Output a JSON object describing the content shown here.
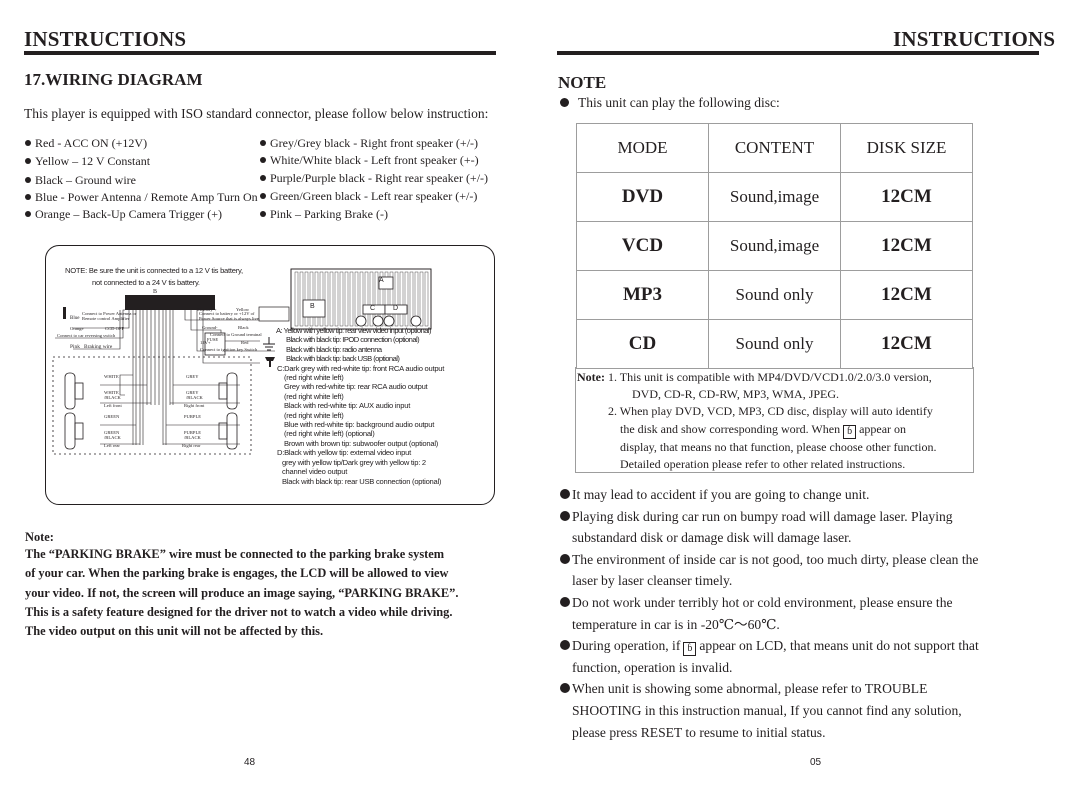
{
  "left_page": {
    "header": "INSTRUCTIONS",
    "section_title": "17.WIRING DIAGRAM",
    "intro": "This player is equipped with ISO standard connector, please follow below instruction:",
    "wires_left": [
      "Red - ACC ON (+12V)",
      "Yellow – 12 V Constant",
      "Black – Ground wire",
      "Blue - Power Antenna / Remote Amp Turn On",
      "Orange – Back-Up Camera Trigger (+)"
    ],
    "wires_right": [
      "Grey/Grey black - Right front speaker (+/-)",
      "White/White black - Left front speaker (+-)",
      "Purple/Purple black - Right rear speaker (+/-)",
      "Green/Green black - Left rear speaker (+/-)",
      "Pink – Parking Brake (-)"
    ],
    "diagram": {
      "note_line1": "NOTE: Be sure the unit is connected to a 12 V tis battery,",
      "note_line2": "not connected to a 24 V tis battery.",
      "connector_b_label": "B",
      "blue_label": "Blue",
      "blue_desc": "Connect to Power Antenna or Remote control Amplifier",
      "orange_label": "Orange",
      "ccd_label": "CCD OFF",
      "reversing_desc": "Connect to car reversing switch",
      "pink_label": "Pink",
      "braking_label": "Braking wire",
      "memory_label": "Memory +",
      "yellow_label": "Yellow",
      "memory_desc": "Connect to battery or +12V of Power Source that is always live.",
      "fuse_label": "FUSE",
      "ground_label": "Ground-",
      "black_label": "Black",
      "ground_desc": "Connect to Ground terminal",
      "v12_label": "12V+",
      "red_label": "Red",
      "ignition_desc": "Connect to ignition key Switch",
      "speakers": {
        "lf_plus": "WHITE",
        "lf_minus": "WHITE /BLACK",
        "lf_caption": "Left front",
        "rf_plus": "GREY",
        "rf_minus": "GREY /BLACK",
        "rf_caption": "Right front",
        "lr_plus": "GREEN",
        "lr_minus": "GREEN /BLACK",
        "lr_caption": "Left rear",
        "rr_plus": "PURPLE",
        "rr_minus": "PURPLE /BLACK",
        "rr_caption": "Right rear",
        "plus_sign": "+",
        "minus_sign": "–"
      },
      "rear_panel_labels": {
        "a": "A",
        "b": "B",
        "c": "C",
        "d": "D"
      },
      "legend_lines": [
        "A: Yellow with yellow tip: rear view video input (optional)",
        "Black with black tip: IPOD connection (optional)",
        "Black with black tip: radio antenna",
        "Black with black tip: back USB (optional)",
        "C:Dark grey with red-white tip: front RCA audio output",
        "(red right white left)",
        "Grey with red-white tip: rear RCA audio output",
        "(red right white left)",
        "Black with red-white tip: AUX audio input",
        "(red right white left)",
        "Blue with red-white tip: background audio output",
        "(red right white left) (optional)",
        "Brown with brown tip: subwoofer output (optional)",
        "D:Black with yellow tip: external video input",
        "grey with yellow tip/Dark grey with yellow tip: 2",
        "channel video output",
        "Black with black tip: rear USB connection (optional)"
      ]
    },
    "note_title": "Note:",
    "note_lines": [
      "The “PARKING BRAKE” wire must be connected to the parking brake system",
      "of your car. When the parking brake is engages, the LCD will be allowed to view",
      "your video. If not, the screen will produce an image saying, “PARKING BRAKE”.",
      "This is a safety feature designed for the driver not to watch a video while driving.",
      "The video output on this unit will not be affected by this."
    ],
    "page_number": "48"
  },
  "right_page": {
    "header": "INSTRUCTIONS",
    "section_title": "NOTE",
    "intro": "This unit can play the following disc:",
    "table": {
      "headers": [
        "MODE",
        "CONTENT",
        "DISK SIZE"
      ],
      "rows": [
        [
          "DVD",
          "Sound,image",
          "12CM"
        ],
        [
          "VCD",
          "Sound,image",
          "12CM"
        ],
        [
          "MP3",
          "Sound only",
          "12CM"
        ],
        [
          "CD",
          "Sound only",
          "12CM"
        ]
      ]
    },
    "table_note": {
      "label": "Note:",
      "line1": "1. This unit is compatible with MP4/DVD/VCD1.0/2.0/3.0 version,",
      "line2": "DVD, CD-R, CD-RW, MP3, WMA, JPEG.",
      "line3": "2. When play DVD, VCD, MP3, CD disc, display will auto identify",
      "line4a": "the disk and show corresponding word. When",
      "line4b": "appear on",
      "line5": "display, that means no that function, please choose other function.",
      "line6": "Detailed operation please refer to other related instructions."
    },
    "invalid_icon_glyph": "ɓ",
    "bullets": [
      {
        "lines": [
          "It may lead to accident if you are going to change unit."
        ]
      },
      {
        "lines": [
          "Playing disk during car run on bumpy road will damage laser. Playing",
          "substandard disk or damage disk will damage laser."
        ]
      },
      {
        "lines": [
          "The environment of inside car is not good, too much dirty, please clean the",
          "laser by laser cleanser timely."
        ]
      },
      {
        "lines": [
          "Do not work under terribly hot or cold environment, please ensure the",
          "temperature in car is in -20℃～60℃."
        ]
      },
      {
        "lines_a": "During operation, if",
        "lines_b": "appear on LCD, that means unit do not support that",
        "line2": "function, operation is invalid."
      },
      {
        "lines": [
          "When unit is showing some abnormal, please refer to TROUBLE",
          "SHOOTING in this instruction manual, If you cannot find any solution,",
          "please press RESET to resume to initial status."
        ]
      }
    ],
    "page_number": "05"
  }
}
